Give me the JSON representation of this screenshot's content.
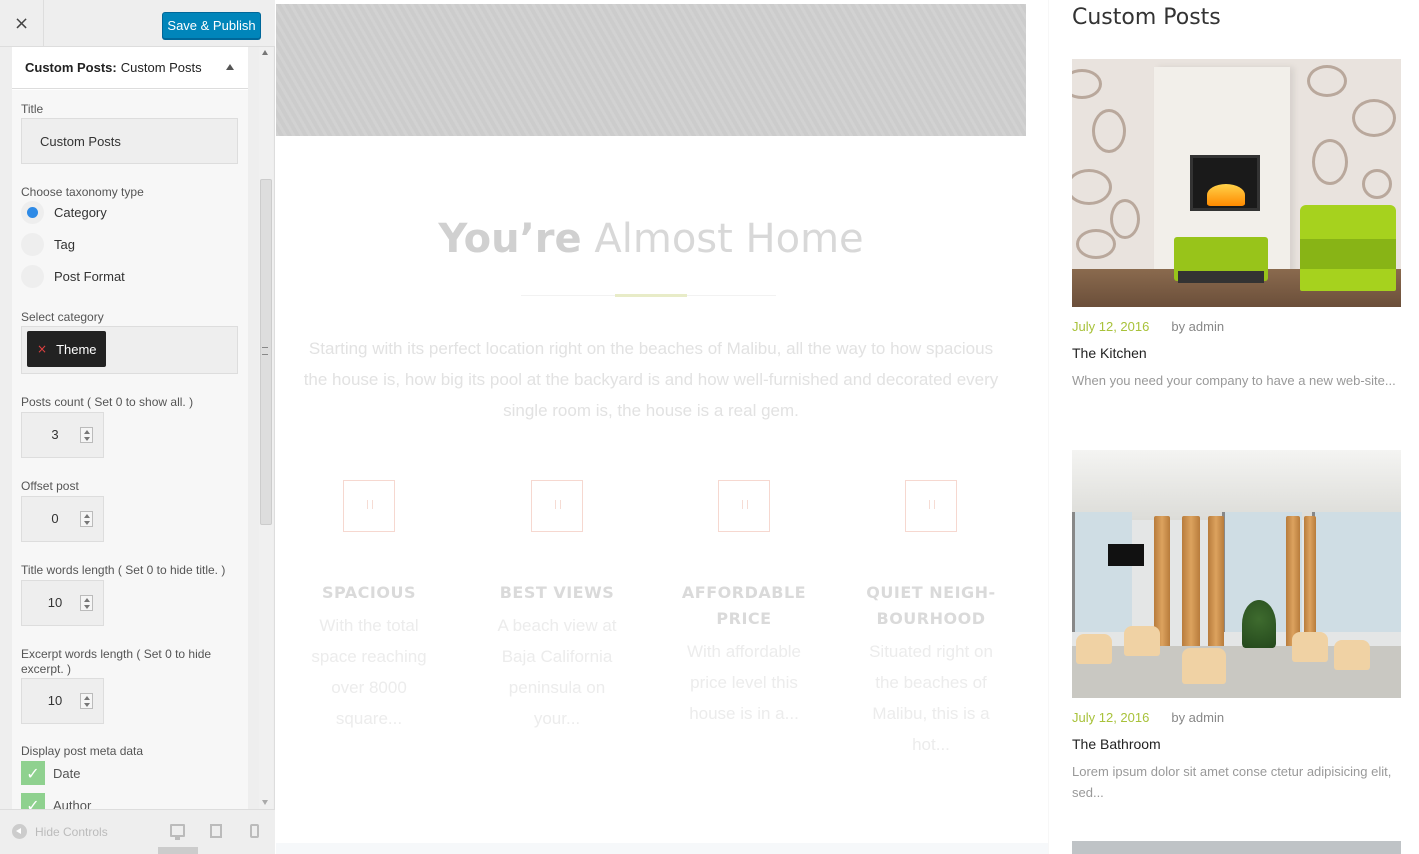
{
  "customizer": {
    "close_label": "×",
    "save_label": "Save & Publish",
    "panel_title_prefix": "Custom Posts:",
    "panel_title_name": "Custom Posts",
    "fields": {
      "title_label": "Title",
      "title_value": "Custom Posts",
      "taxonomy_label": "Choose taxonomy type",
      "taxonomy_options": [
        {
          "label": "Category",
          "checked": true
        },
        {
          "label": "Tag",
          "checked": false
        },
        {
          "label": "Post Format",
          "checked": false
        }
      ],
      "category_label": "Select category",
      "category_chip": "Theme",
      "chip_remove": "×",
      "posts_count_label": "Posts count ( Set 0 to show all. )",
      "posts_count_value": "3",
      "offset_label": "Offset post",
      "offset_value": "0",
      "title_words_label": "Title words length ( Set 0 to hide title. )",
      "title_words_value": "10",
      "excerpt_words_label": "Excerpt words length ( Set 0 to hide excerpt. )",
      "excerpt_words_value": "10",
      "meta_label": "Display post meta data",
      "meta_options": [
        {
          "label": "Date",
          "checked": true
        },
        {
          "label": "Author",
          "checked": true
        }
      ],
      "check_mark": "✓"
    },
    "footer": {
      "hide_label": "Hide Controls"
    }
  },
  "preview": {
    "hero": {
      "title_bold": "You’re",
      "title_light": "Almost Home",
      "description": "Starting with its perfect location right on the beaches of Malibu, all the way to how spacious the house is, how big its pool at the backyard is and how well-furnished and decorated every single room is, the house is a real gem."
    },
    "features": [
      {
        "title": "SPACIOUS",
        "desc": "With the total space reaching over 8000 square..."
      },
      {
        "title": "BEST VIEWS",
        "desc": "A beach view at Baja California peninsula on your..."
      },
      {
        "title": "AFFORDABLE PRICE",
        "desc": "With affordable price level this house is in a..."
      },
      {
        "title": "QUIET NEIGH-BOURHOOD",
        "desc": "Situated right on the beaches of Malibu, this is a hot..."
      }
    ],
    "sidebar_title": "Custom Posts",
    "posts": [
      {
        "date": "July 12, 2016",
        "author": "by admin",
        "title": "The Kitchen",
        "excerpt": "When you need your company to have a new web-site..."
      },
      {
        "date": "July 12, 2016",
        "author": "by admin",
        "title": "The Bathroom",
        "excerpt": "Lorem ipsum dolor sit amet conse ctetur adipisicing elit, sed..."
      }
    ]
  },
  "colors": {
    "accent_blue": "#0085ba",
    "date_green": "#a8c23a",
    "radio_blue": "#2e8ae6",
    "check_green": "#8fd18f"
  },
  "icons": {
    "close": "close-icon",
    "collapse": "chevron-up-icon",
    "hide_controls": "arrow-left-circle-icon",
    "desktop": "desktop-icon",
    "tablet": "tablet-icon",
    "mobile": "mobile-icon",
    "feature": "quote-icon"
  }
}
